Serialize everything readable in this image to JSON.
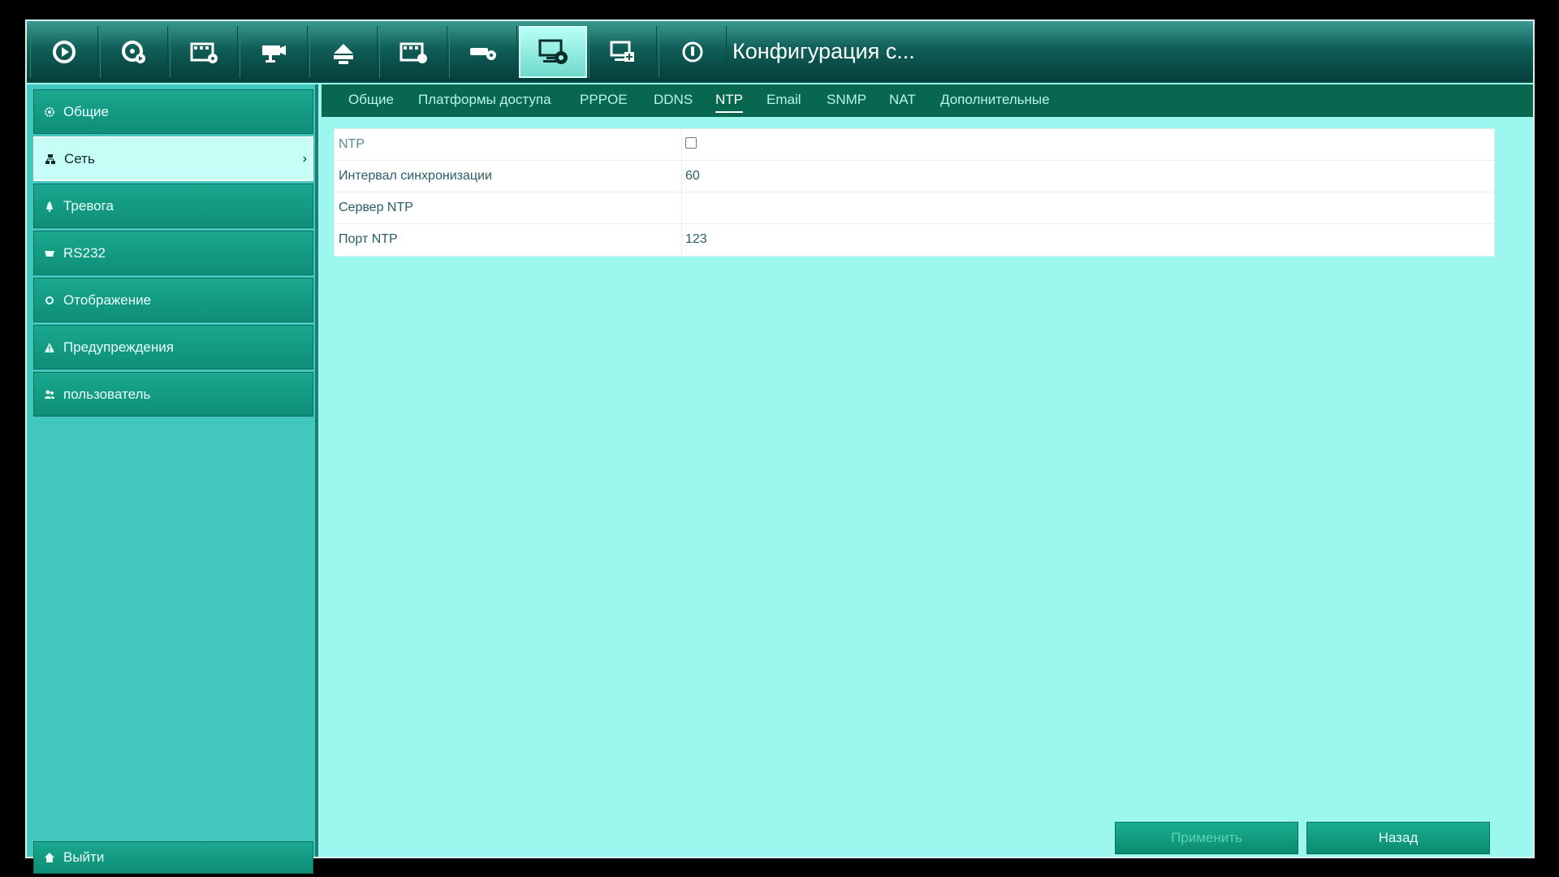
{
  "header": {
    "title": "Конфигурация с...",
    "toolbar_icons": [
      "live-view-icon",
      "playback-icon",
      "record-icon",
      "camera-icon",
      "network-storage-icon",
      "video-icon",
      "device-icon",
      "system-config-icon",
      "display-icon",
      "power-icon"
    ],
    "active_index": 7
  },
  "sidebar": {
    "items": [
      {
        "label": "Общие",
        "icon": "gear-icon"
      },
      {
        "label": "Сеть",
        "icon": "network-icon"
      },
      {
        "label": "Тревога",
        "icon": "alarm-icon"
      },
      {
        "label": "RS232",
        "icon": "serial-icon"
      },
      {
        "label": "Отображение",
        "icon": "display-icon"
      },
      {
        "label": "Предупреждения",
        "icon": "warning-icon"
      },
      {
        "label": "пользователь",
        "icon": "user-icon"
      }
    ],
    "active_index": 1,
    "logout_label": "Выйти"
  },
  "tabs": {
    "items": [
      "Общие",
      "Платформы доступа",
      "PPPOE",
      "DDNS",
      "NTP",
      "Email",
      "SNMP",
      "NAT",
      "Дополнительные"
    ],
    "active": "NTP"
  },
  "form": {
    "ntp_label": "NTP",
    "ntp_enabled": false,
    "interval_label": "Интервал синхронизации",
    "interval_value": "60",
    "server_label": "Сервер NTP",
    "server_value": "",
    "port_label": "Порт NTP",
    "port_value": "123"
  },
  "buttons": {
    "apply": "Применить",
    "back": "Назад"
  },
  "colors": {
    "accent": "#08684f",
    "background": "#9cf7ef",
    "sidebar": "#42c7bc"
  }
}
